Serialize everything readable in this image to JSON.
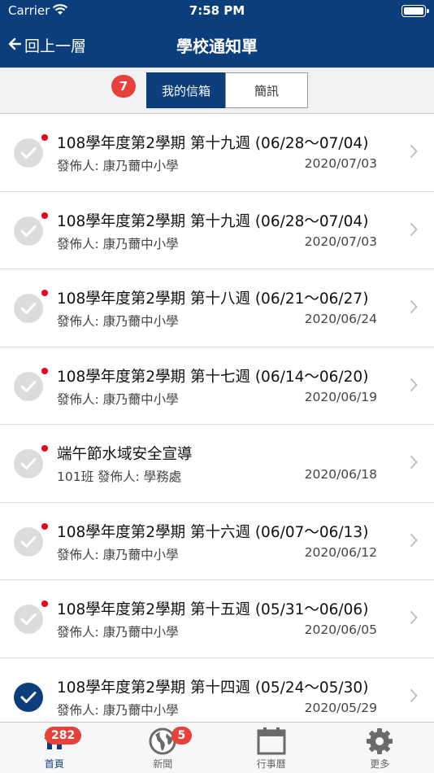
{
  "status": {
    "carrier": "Carrier",
    "time": "7:58 PM"
  },
  "nav": {
    "back_label": "回上一層",
    "title": "學校通知單"
  },
  "segments": {
    "badge": "7",
    "inbox": "我的信箱",
    "sms": "簡訊"
  },
  "messages": [
    {
      "title": "108學年度第2學期 第十九週 (06/28～07/04)",
      "sender": "發佈人: 康乃薾中小學",
      "date": "2020/07/03",
      "unread": true
    },
    {
      "title": "108學年度第2學期 第十九週 (06/28～07/04)",
      "sender": "發佈人: 康乃薾中小學",
      "date": "2020/07/03",
      "unread": true
    },
    {
      "title": "108學年度第2學期 第十八週 (06/21～06/27)",
      "sender": "發佈人: 康乃薾中小學",
      "date": "2020/06/24",
      "unread": true
    },
    {
      "title": "108學年度第2學期 第十七週 (06/14～06/20)",
      "sender": "發佈人: 康乃薾中小學",
      "date": "2020/06/19",
      "unread": true
    },
    {
      "title": "端午節水域安全宣導",
      "sender": "101班 發佈人: 學務處",
      "date": "2020/06/18",
      "unread": true
    },
    {
      "title": "108學年度第2學期 第十六週 (06/07～06/13)",
      "sender": "發佈人: 康乃薾中小學",
      "date": "2020/06/12",
      "unread": true
    },
    {
      "title": "108學年度第2學期 第十五週 (05/31～06/06)",
      "sender": "發佈人: 康乃薾中小學",
      "date": "2020/06/05",
      "unread": true
    },
    {
      "title": "108學年度第2學期 第十四週 (05/24～05/30)",
      "sender": "發佈人: 康乃薾中小學",
      "date": "2020/05/29",
      "unread": false
    }
  ],
  "tabs": [
    {
      "label": "首頁",
      "badge": "282"
    },
    {
      "label": "新聞",
      "badge": "5"
    },
    {
      "label": "行事曆",
      "badge": ""
    },
    {
      "label": "更多",
      "badge": ""
    }
  ],
  "colors": {
    "primary": "#0c3e7b",
    "badge": "#e8413c",
    "unread_dot": "#e8001c"
  }
}
